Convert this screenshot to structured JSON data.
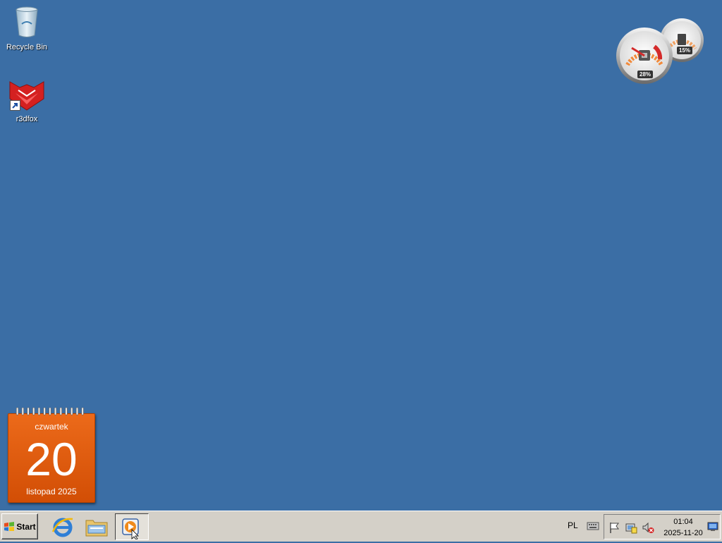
{
  "desktop": {
    "background": "#3b6ea5",
    "icons": [
      {
        "label": "Recycle Bin",
        "icon": "recycle-bin-icon"
      },
      {
        "label": "r3dfox",
        "icon": "r3dfox-icon"
      }
    ]
  },
  "gauge_gadget": {
    "cpu_percent": "28%",
    "memory_percent": "15%"
  },
  "calendar_gadget": {
    "weekday": "czwartek",
    "day": "20",
    "month_year": "listopad 2025",
    "color": "#e05a0c"
  },
  "taskbar": {
    "start_label": "Start",
    "quick_launch": [
      {
        "icon": "internet-explorer-icon"
      },
      {
        "icon": "windows-explorer-icon"
      },
      {
        "icon": "media-player-icon"
      }
    ],
    "language": "PL",
    "clock": {
      "time": "01:04",
      "date": "2025-11-20"
    }
  }
}
